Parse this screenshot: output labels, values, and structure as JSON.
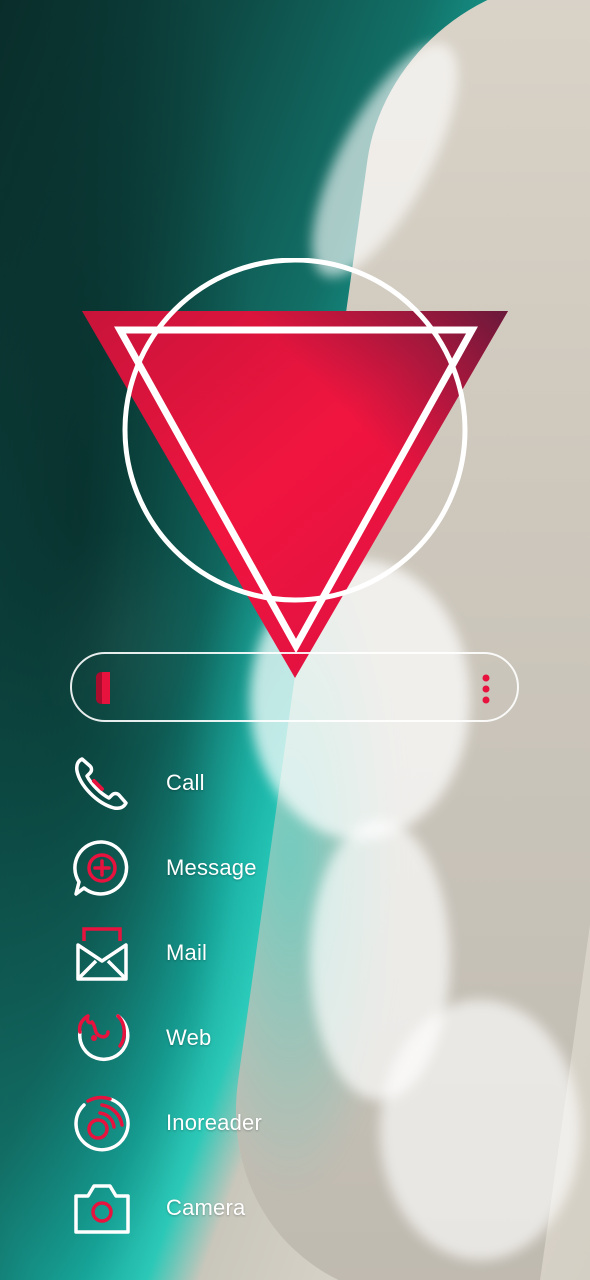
{
  "theme": {
    "accent": "#e8123e",
    "foreground": "#ffffff"
  },
  "logo": {
    "icon": "triangle-circle-logo"
  },
  "search_bar": {
    "left_icon": "brand-logo-icon",
    "right_icon": "more-vertical-icon"
  },
  "apps": [
    {
      "label": "Call",
      "icon": "phone-icon"
    },
    {
      "label": "Message",
      "icon": "message-plus-icon"
    },
    {
      "label": "Mail",
      "icon": "mail-icon"
    },
    {
      "label": "Web",
      "icon": "firefox-icon"
    },
    {
      "label": "Inoreader",
      "icon": "rss-icon"
    },
    {
      "label": "Camera",
      "icon": "camera-icon"
    }
  ]
}
